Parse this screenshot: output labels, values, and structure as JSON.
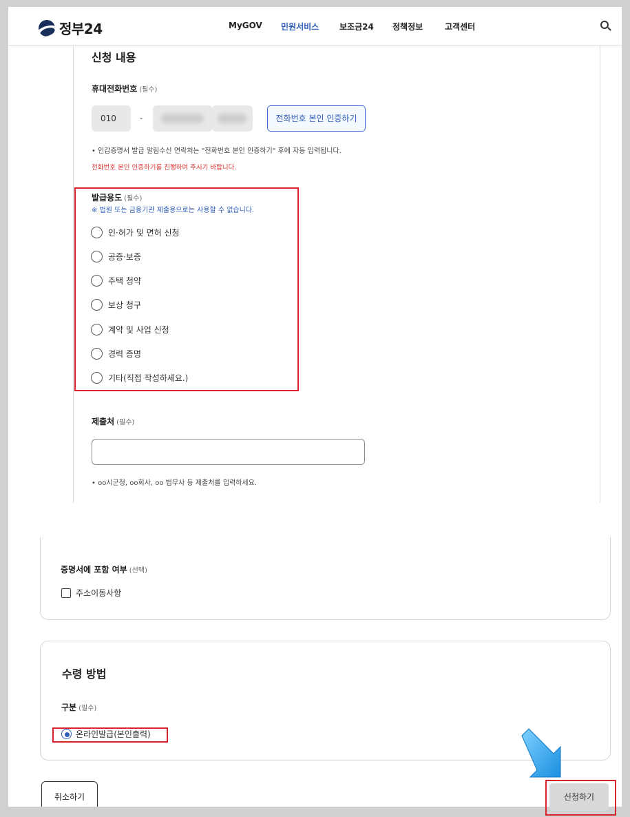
{
  "header": {
    "logo_text": "정부24",
    "nav": [
      "MyGOV",
      "민원서비스",
      "보조금24",
      "정책정보",
      "고객센터"
    ],
    "active_nav": "민원서비스",
    "search_icon": "search-icon"
  },
  "application": {
    "section_title": "신청 내용",
    "phone": {
      "label": "휴대전화번호",
      "required": "(필수)",
      "prefix": "010",
      "separator": "-",
      "verify_button": "전화번호 본인 인증하기",
      "note": "• 인감증명서 발급 알림수신 연락처는 \"전화번호 본인 인증하기\" 후에 자동 입력됩니다.",
      "warning": "전화번호 본인 인증하기를 진행하여 주시기 바랍니다."
    },
    "purpose": {
      "label": "발급용도",
      "required": "(필수)",
      "notice": "※ 법원 또는 금융기관 제출용으로는 사용할 수 없습니다.",
      "options": [
        "인·허가 및 면허 신청",
        "공증·보증",
        "주택 청약",
        "보상 청구",
        "계약 및 사업 신청",
        "경력 증명",
        "기타(직접 작성하세요.)"
      ]
    },
    "destination": {
      "label": "제출처",
      "required": "(필수)",
      "value": "",
      "note": "• oo시군청, oo회사, oo 법무사 등 제출처를 입력하세요."
    }
  },
  "inclusion": {
    "label": "증명서에 포함 여부",
    "optional": "(선택)",
    "checkbox_label": "주소이동사항",
    "checked": false
  },
  "receipt": {
    "title": "수령 방법",
    "label": "구분",
    "required": "(필수)",
    "option": "온라인발급(본인출력)",
    "selected": true
  },
  "buttons": {
    "cancel": "취소하기",
    "apply": "신청하기"
  },
  "colors": {
    "accent": "#2d5db8",
    "highlight": "#d8232a",
    "arrow": "#29a3e6"
  }
}
